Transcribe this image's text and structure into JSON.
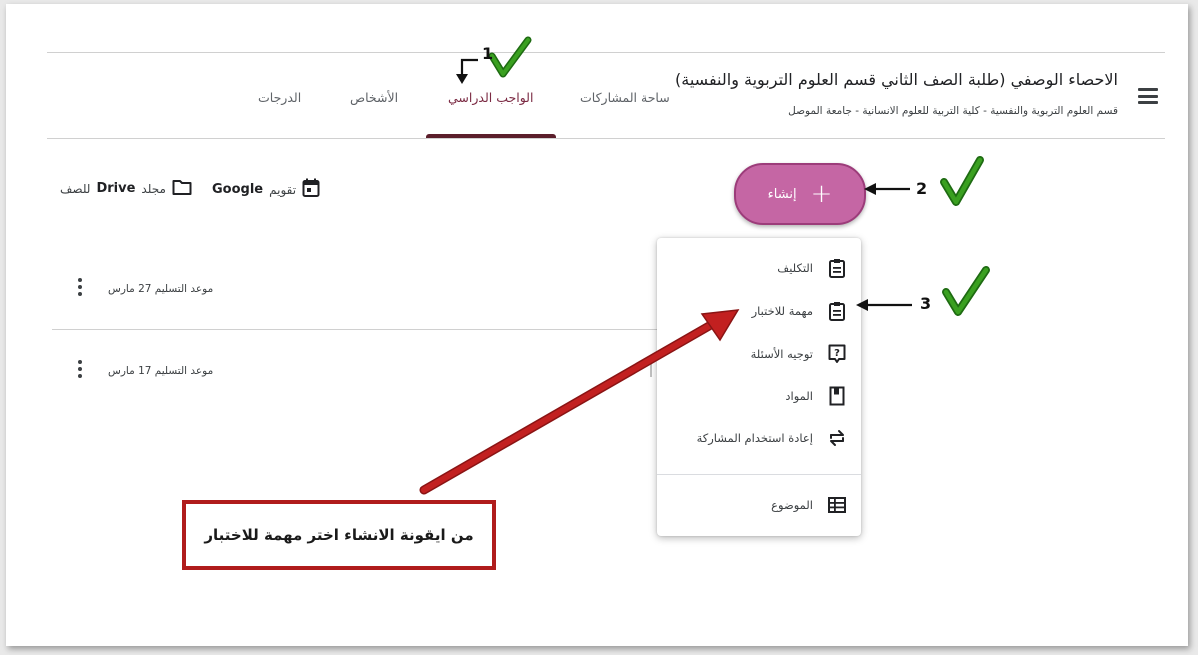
{
  "header": {
    "class_title": "الاحصاء الوصفي (طلبة الصف الثاني قسم العلوم التربوية والنفسية)",
    "class_subtitle": "قسم العلوم التربوية والنفسية - كلية التربية للعلوم الانسانية - جامعة الموصل",
    "menu_icon": "hamburger-icon"
  },
  "tabs": [
    {
      "label": "ساحة المشاركات"
    },
    {
      "label": "الواجب الدراسي",
      "active": true
    },
    {
      "label": "الأشخاص"
    },
    {
      "label": "الدرجات"
    }
  ],
  "toolbar": {
    "create_label": "إنشاء",
    "calendar_label": "تقويم",
    "calendar_brand": "Google",
    "drive_label_pre": "مجلد",
    "drive_brand": "Drive",
    "drive_label_post": "للصف"
  },
  "assignments": [
    {
      "due": "موعد التسليم 27 مارس"
    },
    {
      "due": "موعد التسليم 17 مارس"
    }
  ],
  "create_menu": {
    "items": [
      {
        "label": "التكليف",
        "icon": "assignment-icon"
      },
      {
        "label": "مهمة للاختبار",
        "icon": "quiz-assignment-icon"
      },
      {
        "label": "توجيه الأسئلة",
        "icon": "question-icon"
      },
      {
        "label": "المواد",
        "icon": "material-icon"
      },
      {
        "label": "إعادة استخدام المشاركة",
        "icon": "reuse-post-icon"
      }
    ],
    "topic": {
      "label": "الموضوع",
      "icon": "topic-icon"
    }
  },
  "annotations": {
    "step1": "1",
    "step2": "2",
    "step3": "3",
    "note": "من ايقونة الانشاء اختر مهمة للاختبار",
    "colors": {
      "arrow": "#b01c1c",
      "check": "#3aa020",
      "accent": "#c566a4"
    }
  }
}
